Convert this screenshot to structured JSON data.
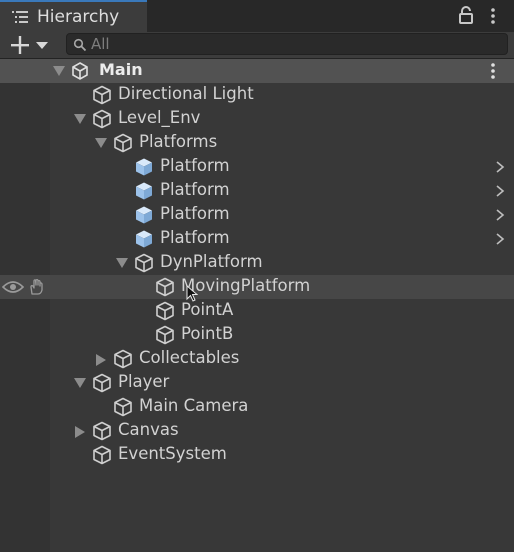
{
  "tab": {
    "label": "Hierarchy"
  },
  "toolbar": {
    "search_placeholder": "All"
  },
  "scene": {
    "name": "Main"
  },
  "colors": {
    "accent": "#3a79bb",
    "hover": "#474747",
    "header": "#525252"
  },
  "items": [
    {
      "label": "Directional Light",
      "depth": 0,
      "expander": "none",
      "prefab": false
    },
    {
      "label": "Level_Env",
      "depth": 0,
      "expander": "expanded",
      "prefab": false
    },
    {
      "label": "Platforms",
      "depth": 1,
      "expander": "expanded",
      "prefab": false
    },
    {
      "label": "Platform",
      "depth": 2,
      "expander": "none",
      "prefab": true,
      "chevron": true
    },
    {
      "label": "Platform",
      "depth": 2,
      "expander": "none",
      "prefab": true,
      "chevron": true
    },
    {
      "label": "Platform",
      "depth": 2,
      "expander": "none",
      "prefab": true,
      "chevron": true
    },
    {
      "label": "Platform",
      "depth": 2,
      "expander": "none",
      "prefab": true,
      "chevron": true
    },
    {
      "label": "DynPlatform",
      "depth": 2,
      "expander": "expanded",
      "prefab": false
    },
    {
      "label": "MovingPlatform",
      "depth": 3,
      "expander": "none",
      "prefab": false,
      "hovered": true
    },
    {
      "label": "PointA",
      "depth": 3,
      "expander": "none",
      "prefab": false
    },
    {
      "label": "PointB",
      "depth": 3,
      "expander": "none",
      "prefab": false
    },
    {
      "label": "Collectables",
      "depth": 1,
      "expander": "collapsed",
      "prefab": false
    },
    {
      "label": "Player",
      "depth": 0,
      "expander": "expanded",
      "prefab": false
    },
    {
      "label": "Main Camera",
      "depth": 1,
      "expander": "none",
      "prefab": false
    },
    {
      "label": "Canvas",
      "depth": 0,
      "expander": "collapsed",
      "prefab": false
    },
    {
      "label": "EventSystem",
      "depth": 0,
      "expander": "none",
      "prefab": false
    }
  ]
}
